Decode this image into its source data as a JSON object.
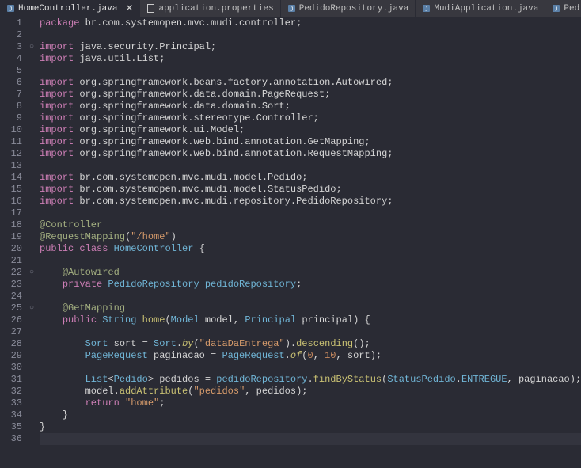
{
  "tabs": [
    {
      "label": "HomeController.java",
      "active": true,
      "icon": "java"
    },
    {
      "label": "application.properties",
      "active": false,
      "icon": "file"
    },
    {
      "label": "PedidoRepository.java",
      "active": false,
      "icon": "java"
    },
    {
      "label": "MudiApplication.java",
      "active": false,
      "icon": "java"
    },
    {
      "label": "PedidoRes",
      "active": false,
      "icon": "java"
    }
  ],
  "close_x": "✕",
  "gutter": {
    "start": 1,
    "end": 36
  },
  "fold_markers": {
    "3": "circle",
    "22": "circle",
    "25": "circle"
  },
  "chart_data": {
    "type": "table",
    "language": "java",
    "lines": [
      {
        "n": 1,
        "tokens": [
          [
            "kw",
            "package"
          ],
          [
            "pkg",
            " br.com.systemopen.mvc.mudi.controller;"
          ]
        ]
      },
      {
        "n": 2,
        "tokens": []
      },
      {
        "n": 3,
        "tokens": [
          [
            "kw",
            "import"
          ],
          [
            "pkg",
            " java.security.Principal;"
          ]
        ]
      },
      {
        "n": 4,
        "tokens": [
          [
            "kw",
            "import"
          ],
          [
            "pkg",
            " java.util.List;"
          ]
        ]
      },
      {
        "n": 5,
        "tokens": []
      },
      {
        "n": 6,
        "tokens": [
          [
            "kw",
            "import"
          ],
          [
            "pkg",
            " org.springframework.beans.factory.annotation.Autowired;"
          ]
        ]
      },
      {
        "n": 7,
        "tokens": [
          [
            "kw",
            "import"
          ],
          [
            "pkg",
            " org.springframework.data.domain.PageRequest;"
          ]
        ]
      },
      {
        "n": 8,
        "tokens": [
          [
            "kw",
            "import"
          ],
          [
            "pkg",
            " org.springframework.data.domain.Sort;"
          ]
        ]
      },
      {
        "n": 9,
        "tokens": [
          [
            "kw",
            "import"
          ],
          [
            "pkg",
            " org.springframework.stereotype.Controller;"
          ]
        ]
      },
      {
        "n": 10,
        "tokens": [
          [
            "kw",
            "import"
          ],
          [
            "pkg",
            " org.springframework.ui.Model;"
          ]
        ]
      },
      {
        "n": 11,
        "tokens": [
          [
            "kw",
            "import"
          ],
          [
            "pkg",
            " org.springframework.web.bind.annotation.GetMapping;"
          ]
        ]
      },
      {
        "n": 12,
        "tokens": [
          [
            "kw",
            "import"
          ],
          [
            "pkg",
            " org.springframework.web.bind.annotation.RequestMapping;"
          ]
        ]
      },
      {
        "n": 13,
        "tokens": []
      },
      {
        "n": 14,
        "tokens": [
          [
            "kw",
            "import"
          ],
          [
            "pkg",
            " br.com.systemopen.mvc.mudi.model.Pedido;"
          ]
        ]
      },
      {
        "n": 15,
        "tokens": [
          [
            "kw",
            "import"
          ],
          [
            "pkg",
            " br.com.systemopen.mvc.mudi.model.StatusPedido;"
          ]
        ]
      },
      {
        "n": 16,
        "tokens": [
          [
            "kw",
            "import"
          ],
          [
            "pkg",
            " br.com.systemopen.mvc.mudi.repository.PedidoRepository;"
          ]
        ]
      },
      {
        "n": 17,
        "tokens": []
      },
      {
        "n": 18,
        "tokens": [
          [
            "ann",
            "@Controller"
          ]
        ]
      },
      {
        "n": 19,
        "tokens": [
          [
            "ann",
            "@RequestMapping"
          ],
          [
            "pkg",
            "("
          ],
          [
            "str",
            "\"/home\""
          ],
          [
            "pkg",
            ")"
          ]
        ]
      },
      {
        "n": 20,
        "tokens": [
          [
            "kw",
            "public "
          ],
          [
            "kw",
            "class "
          ],
          [
            "type",
            "HomeController"
          ],
          [
            "pkg",
            " {"
          ]
        ]
      },
      {
        "n": 21,
        "tokens": []
      },
      {
        "n": 22,
        "tokens": [
          [
            "pkg",
            "    "
          ],
          [
            "ann",
            "@Autowired"
          ]
        ]
      },
      {
        "n": 23,
        "tokens": [
          [
            "pkg",
            "    "
          ],
          [
            "kw",
            "private "
          ],
          [
            "type",
            "PedidoRepository "
          ],
          [
            "field",
            "pedidoRepository"
          ],
          [
            "pkg",
            ";"
          ]
        ]
      },
      {
        "n": 24,
        "tokens": []
      },
      {
        "n": 25,
        "tokens": [
          [
            "pkg",
            "    "
          ],
          [
            "ann",
            "@GetMapping"
          ]
        ]
      },
      {
        "n": 26,
        "tokens": [
          [
            "pkg",
            "    "
          ],
          [
            "kw",
            "public "
          ],
          [
            "type",
            "String "
          ],
          [
            "call",
            "home"
          ],
          [
            "pkg",
            "("
          ],
          [
            "type",
            "Model "
          ],
          [
            "pkg",
            "model, "
          ],
          [
            "type",
            "Principal "
          ],
          [
            "pkg",
            "principal) {"
          ]
        ]
      },
      {
        "n": 27,
        "tokens": []
      },
      {
        "n": 28,
        "tokens": [
          [
            "pkg",
            "        "
          ],
          [
            "type",
            "Sort "
          ],
          [
            "pkg",
            "sort = "
          ],
          [
            "type",
            "Sort"
          ],
          [
            "pkg",
            "."
          ],
          [
            "static-call",
            "by"
          ],
          [
            "pkg",
            "("
          ],
          [
            "str",
            "\"dataDaEntrega\""
          ],
          [
            "pkg",
            ")."
          ],
          [
            "call",
            "descending"
          ],
          [
            "pkg",
            "();"
          ]
        ]
      },
      {
        "n": 29,
        "tokens": [
          [
            "pkg",
            "        "
          ],
          [
            "type",
            "PageRequest "
          ],
          [
            "pkg",
            "paginacao = "
          ],
          [
            "type",
            "PageRequest"
          ],
          [
            "pkg",
            "."
          ],
          [
            "static-call",
            "of"
          ],
          [
            "pkg",
            "("
          ],
          [
            "num",
            "0"
          ],
          [
            "pkg",
            ", "
          ],
          [
            "num",
            "10"
          ],
          [
            "pkg",
            ", sort);"
          ]
        ]
      },
      {
        "n": 30,
        "tokens": []
      },
      {
        "n": 31,
        "tokens": [
          [
            "pkg",
            "        "
          ],
          [
            "type",
            "List"
          ],
          [
            "pkg",
            "<"
          ],
          [
            "type",
            "Pedido"
          ],
          [
            "pkg",
            "> pedidos = "
          ],
          [
            "field",
            "pedidoRepository"
          ],
          [
            "pkg",
            "."
          ],
          [
            "call",
            "findByStatus"
          ],
          [
            "pkg",
            "("
          ],
          [
            "type",
            "StatusPedido"
          ],
          [
            "pkg",
            "."
          ],
          [
            "enum-const",
            "ENTREGUE"
          ],
          [
            "pkg",
            ", paginacao);"
          ]
        ]
      },
      {
        "n": 32,
        "tokens": [
          [
            "pkg",
            "        model."
          ],
          [
            "call",
            "addAttribute"
          ],
          [
            "pkg",
            "("
          ],
          [
            "str",
            "\"pedidos\""
          ],
          [
            "pkg",
            ", pedidos);"
          ]
        ]
      },
      {
        "n": 33,
        "tokens": [
          [
            "pkg",
            "        "
          ],
          [
            "kw",
            "return "
          ],
          [
            "str",
            "\"home\""
          ],
          [
            "pkg",
            ";"
          ]
        ]
      },
      {
        "n": 34,
        "tokens": [
          [
            "pkg",
            "    }"
          ]
        ]
      },
      {
        "n": 35,
        "tokens": [
          [
            "pkg",
            "}"
          ]
        ]
      },
      {
        "n": 36,
        "tokens": [],
        "cursor": true
      }
    ]
  }
}
